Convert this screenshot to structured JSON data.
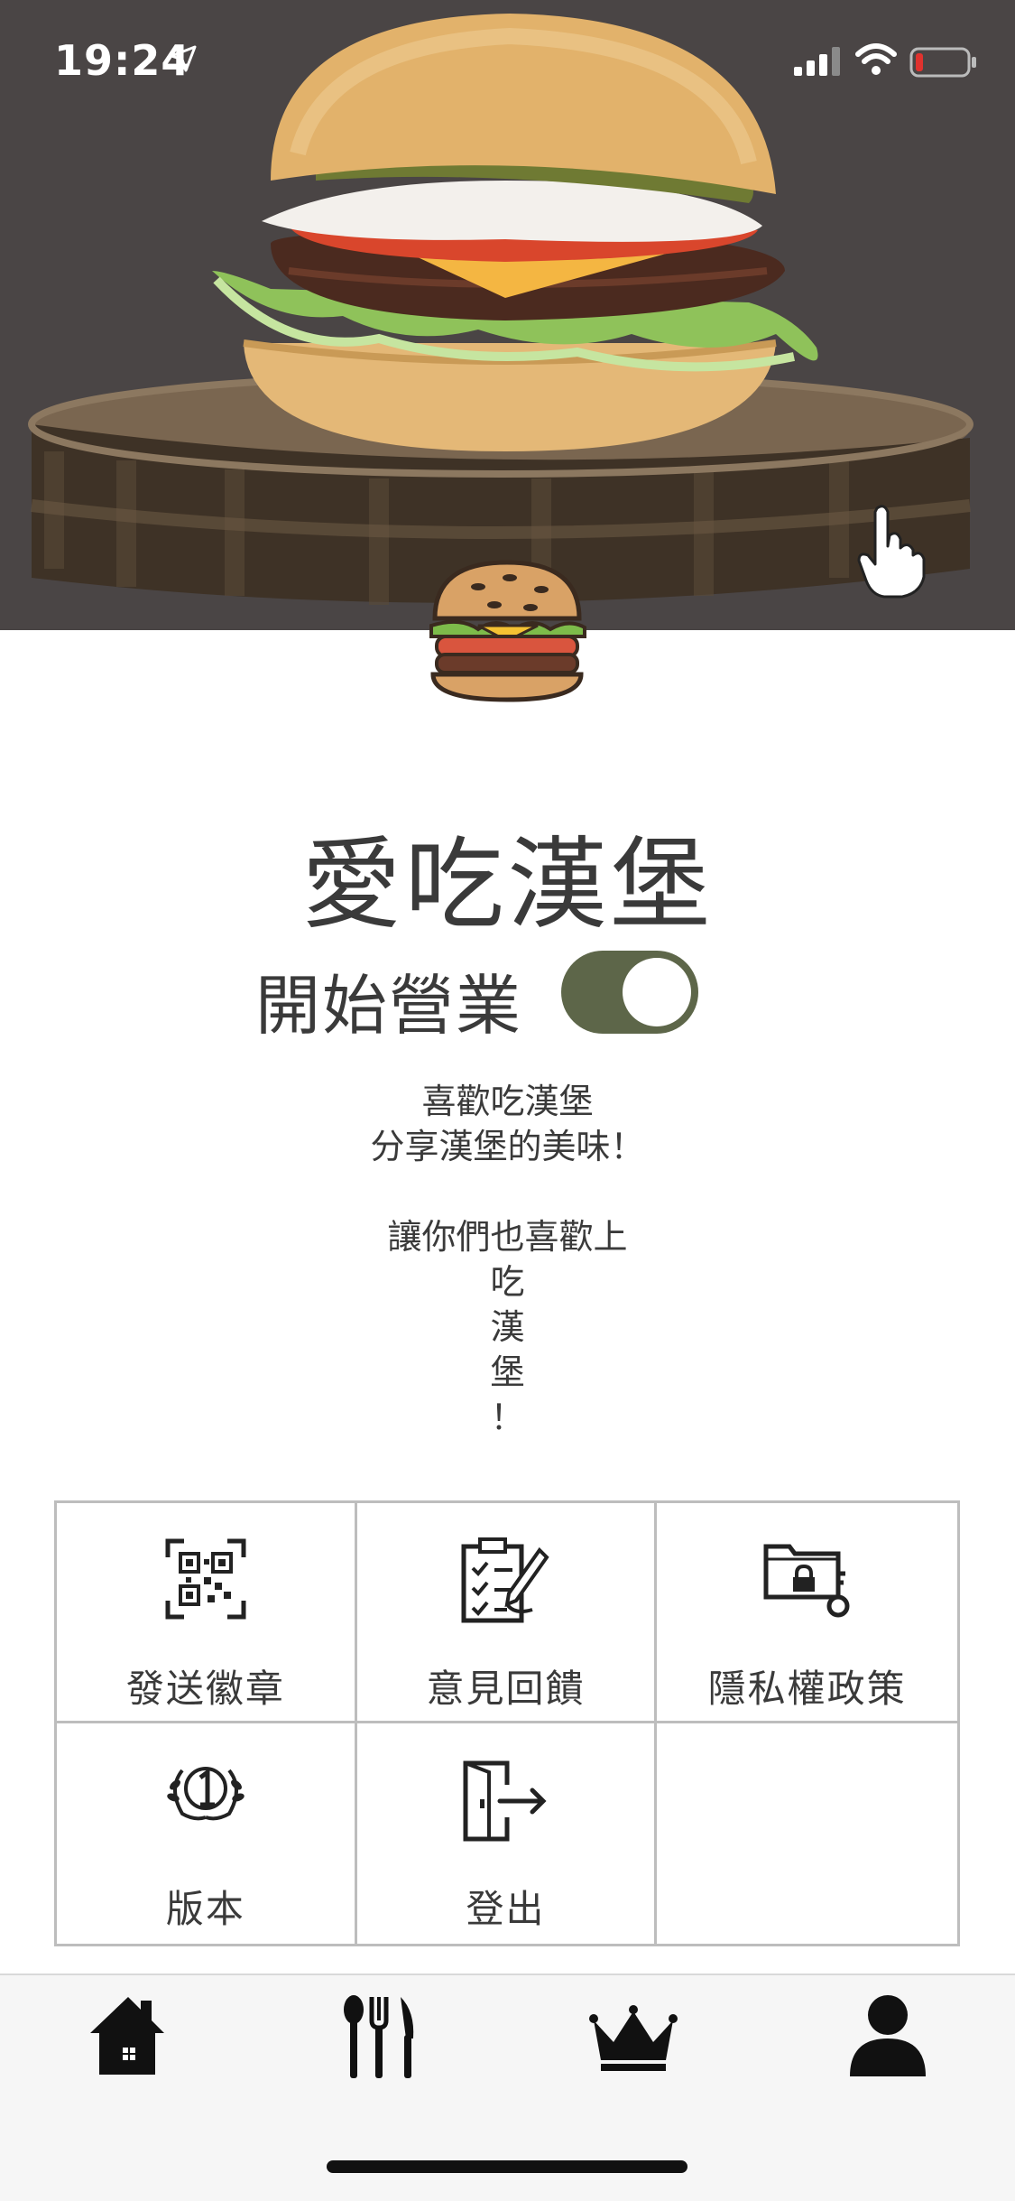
{
  "status_bar": {
    "time": "19:24",
    "icons": [
      "location-arrow-icon",
      "signal-icon",
      "wifi-icon",
      "battery-low-icon"
    ],
    "battery_color": "#e0322e"
  },
  "hero": {
    "image_subject": "burger-on-wooden-board",
    "background": "#4a4545",
    "tap_hint_icon": "hand-pointer-icon"
  },
  "logo_icon": "burger-logo-icon",
  "store": {
    "title": "愛吃漢堡",
    "open_label": "開始營業",
    "open_toggle_on": true,
    "toggle_color": "#5d6649"
  },
  "description": {
    "lines": [
      "喜歡吃漢堡",
      "分享漢堡的美味！",
      "",
      "讓你們也喜歡上",
      "吃",
      "漢",
      "堡",
      "！"
    ]
  },
  "menu_grid": {
    "items": [
      {
        "label": "發送徽章",
        "icon": "qr-code-icon"
      },
      {
        "label": "意見回饋",
        "icon": "feedback-form-icon"
      },
      {
        "label": "隱私權政策",
        "icon": "privacy-folder-key-icon"
      },
      {
        "label": "版本",
        "icon": "version-laurel-icon"
      },
      {
        "label": "登出",
        "icon": "logout-door-icon"
      },
      {
        "label": "",
        "icon": ""
      }
    ]
  },
  "tab_bar": {
    "tabs": [
      {
        "name": "home",
        "icon": "home-icon"
      },
      {
        "name": "restaurant",
        "icon": "utensils-icon"
      },
      {
        "name": "ranking",
        "icon": "crown-icon"
      },
      {
        "name": "profile",
        "icon": "user-icon",
        "selected": true
      }
    ]
  }
}
